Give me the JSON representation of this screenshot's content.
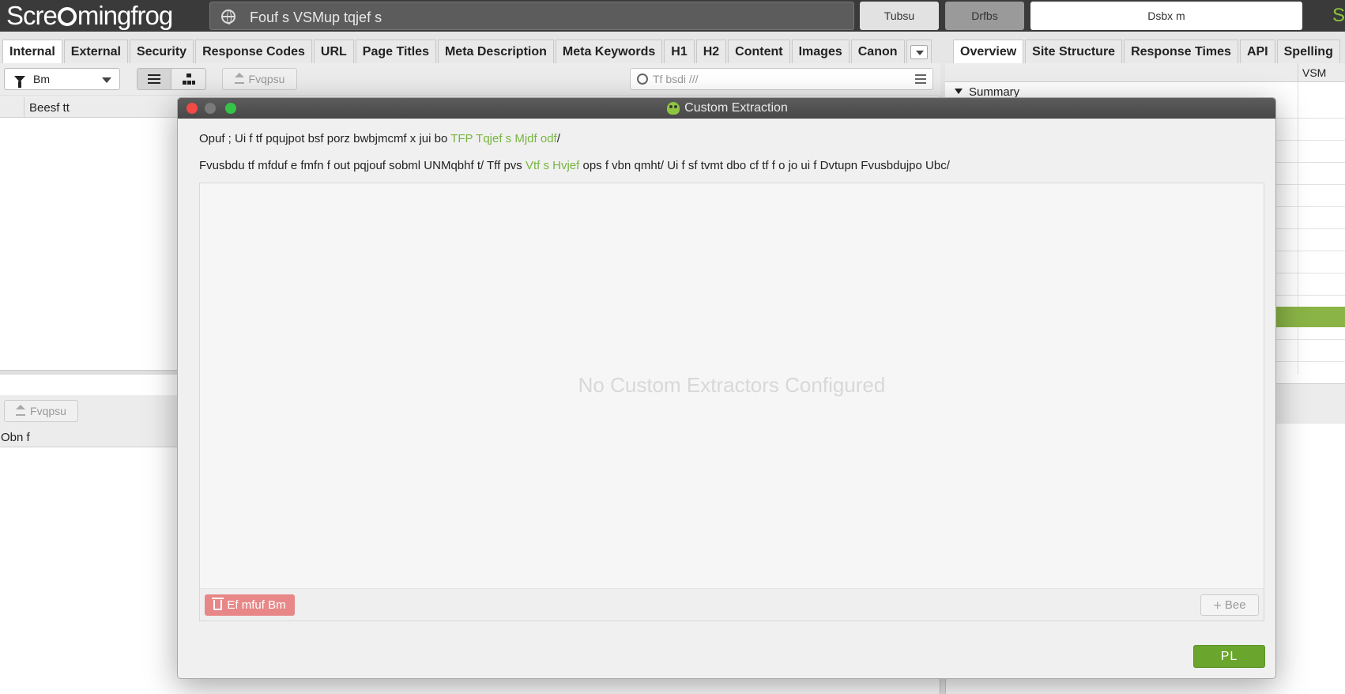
{
  "app": {
    "logo_text_a": "Scre",
    "logo_text_b": "mingfrog",
    "url_text": "Fouf s VSMup tqjef s",
    "start_label": "Tubsu",
    "clear_label": "Drfbs",
    "crawl_label": "Dsbx m",
    "seo_label": "SE"
  },
  "left_tabs": [
    "Internal",
    "External",
    "Security",
    "Response Codes",
    "URL",
    "Page Titles",
    "Meta Description",
    "Meta Keywords",
    "H1",
    "H2",
    "Content",
    "Images",
    "Canon"
  ],
  "right_tabs": [
    "Overview",
    "Site Structure",
    "Response Times",
    "API",
    "Spelling"
  ],
  "toolbar": {
    "filter_label": "Bm",
    "export_label": "Fvqpsu",
    "search_placeholder": "Tf bsdi ///"
  },
  "main_table": {
    "column_address": "Beesf tt"
  },
  "lower_panel": {
    "export_label": "Fvqpsu",
    "column_name": "Obn f"
  },
  "right_panel": {
    "column_url": "VSM",
    "summary_label": "Summary"
  },
  "modal": {
    "title": "Custom Extraction",
    "note1_prefix": "Opuf ; Ui f tf pqujpot bsf porz bwbjmcmf x jui bo ",
    "note1_link": "TFP Tqjef s Mjdf odf",
    "note1_suffix": "/",
    "note2_prefix": "Fvusbdu tf mfduf e fmfn f out pqjouf sobml UNMqbhf t/ Tff pvs ",
    "note2_link": "Vtf s Hvjef",
    "note2_suffix": " ops f vbn qmht/ Ui f sf tvmt dbo cf tf f o jo ui f Dvtupn Fvusbdujpo Ubc/",
    "empty_text": "No Custom Extractors Configured",
    "delete_label": "Ef mfuf Bm",
    "add_label": "Bee",
    "ok_label": "PL"
  },
  "colors": {
    "accent_green": "#6aa62e",
    "link_green": "#77b540",
    "delete_red": "#e88787"
  }
}
